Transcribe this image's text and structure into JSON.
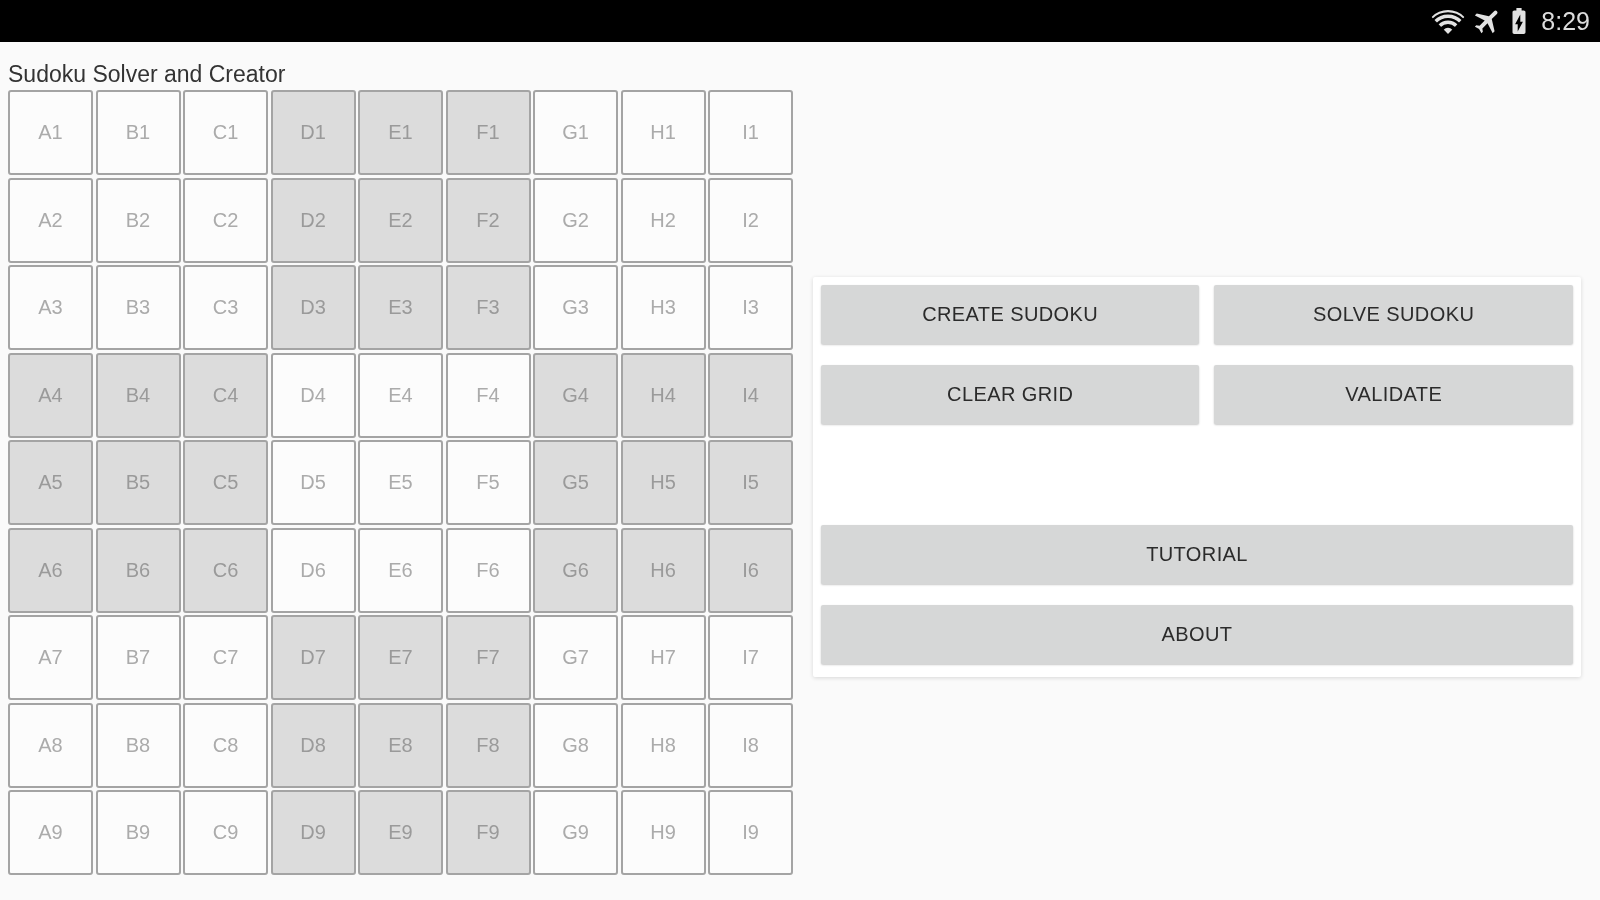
{
  "status_bar": {
    "time": "8:29"
  },
  "title": "Sudoku Solver and Creator",
  "grid": {
    "rows": [
      {
        "cells": [
          {
            "placeholder": "A1",
            "shaded": false
          },
          {
            "placeholder": "B1",
            "shaded": false
          },
          {
            "placeholder": "C1",
            "shaded": false
          },
          {
            "placeholder": "D1",
            "shaded": true
          },
          {
            "placeholder": "E1",
            "shaded": true
          },
          {
            "placeholder": "F1",
            "shaded": true
          },
          {
            "placeholder": "G1",
            "shaded": false
          },
          {
            "placeholder": "H1",
            "shaded": false
          },
          {
            "placeholder": "I1",
            "shaded": false
          }
        ]
      },
      {
        "cells": [
          {
            "placeholder": "A2",
            "shaded": false
          },
          {
            "placeholder": "B2",
            "shaded": false
          },
          {
            "placeholder": "C2",
            "shaded": false
          },
          {
            "placeholder": "D2",
            "shaded": true
          },
          {
            "placeholder": "E2",
            "shaded": true
          },
          {
            "placeholder": "F2",
            "shaded": true
          },
          {
            "placeholder": "G2",
            "shaded": false
          },
          {
            "placeholder": "H2",
            "shaded": false
          },
          {
            "placeholder": "I2",
            "shaded": false
          }
        ]
      },
      {
        "cells": [
          {
            "placeholder": "A3",
            "shaded": false
          },
          {
            "placeholder": "B3",
            "shaded": false
          },
          {
            "placeholder": "C3",
            "shaded": false
          },
          {
            "placeholder": "D3",
            "shaded": true
          },
          {
            "placeholder": "E3",
            "shaded": true
          },
          {
            "placeholder": "F3",
            "shaded": true
          },
          {
            "placeholder": "G3",
            "shaded": false
          },
          {
            "placeholder": "H3",
            "shaded": false
          },
          {
            "placeholder": "I3",
            "shaded": false
          }
        ]
      },
      {
        "cells": [
          {
            "placeholder": "A4",
            "shaded": true
          },
          {
            "placeholder": "B4",
            "shaded": true
          },
          {
            "placeholder": "C4",
            "shaded": true
          },
          {
            "placeholder": "D4",
            "shaded": false
          },
          {
            "placeholder": "E4",
            "shaded": false
          },
          {
            "placeholder": "F4",
            "shaded": false
          },
          {
            "placeholder": "G4",
            "shaded": true
          },
          {
            "placeholder": "H4",
            "shaded": true
          },
          {
            "placeholder": "I4",
            "shaded": true
          }
        ]
      },
      {
        "cells": [
          {
            "placeholder": "A5",
            "shaded": true
          },
          {
            "placeholder": "B5",
            "shaded": true
          },
          {
            "placeholder": "C5",
            "shaded": true
          },
          {
            "placeholder": "D5",
            "shaded": false
          },
          {
            "placeholder": "E5",
            "shaded": false
          },
          {
            "placeholder": "F5",
            "shaded": false
          },
          {
            "placeholder": "G5",
            "shaded": true
          },
          {
            "placeholder": "H5",
            "shaded": true
          },
          {
            "placeholder": "I5",
            "shaded": true
          }
        ]
      },
      {
        "cells": [
          {
            "placeholder": "A6",
            "shaded": true
          },
          {
            "placeholder": "B6",
            "shaded": true
          },
          {
            "placeholder": "C6",
            "shaded": true
          },
          {
            "placeholder": "D6",
            "shaded": false
          },
          {
            "placeholder": "E6",
            "shaded": false
          },
          {
            "placeholder": "F6",
            "shaded": false
          },
          {
            "placeholder": "G6",
            "shaded": true
          },
          {
            "placeholder": "H6",
            "shaded": true
          },
          {
            "placeholder": "I6",
            "shaded": true
          }
        ]
      },
      {
        "cells": [
          {
            "placeholder": "A7",
            "shaded": false
          },
          {
            "placeholder": "B7",
            "shaded": false
          },
          {
            "placeholder": "C7",
            "shaded": false
          },
          {
            "placeholder": "D7",
            "shaded": true
          },
          {
            "placeholder": "E7",
            "shaded": true
          },
          {
            "placeholder": "F7",
            "shaded": true
          },
          {
            "placeholder": "G7",
            "shaded": false
          },
          {
            "placeholder": "H7",
            "shaded": false
          },
          {
            "placeholder": "I7",
            "shaded": false
          }
        ]
      },
      {
        "cells": [
          {
            "placeholder": "A8",
            "shaded": false
          },
          {
            "placeholder": "B8",
            "shaded": false
          },
          {
            "placeholder": "C8",
            "shaded": false
          },
          {
            "placeholder": "D8",
            "shaded": true
          },
          {
            "placeholder": "E8",
            "shaded": true
          },
          {
            "placeholder": "F8",
            "shaded": true
          },
          {
            "placeholder": "G8",
            "shaded": false
          },
          {
            "placeholder": "H8",
            "shaded": false
          },
          {
            "placeholder": "I8",
            "shaded": false
          }
        ]
      },
      {
        "cells": [
          {
            "placeholder": "A9",
            "shaded": false
          },
          {
            "placeholder": "B9",
            "shaded": false
          },
          {
            "placeholder": "C9",
            "shaded": false
          },
          {
            "placeholder": "D9",
            "shaded": true
          },
          {
            "placeholder": "E9",
            "shaded": true
          },
          {
            "placeholder": "F9",
            "shaded": true
          },
          {
            "placeholder": "G9",
            "shaded": false
          },
          {
            "placeholder": "H9",
            "shaded": false
          },
          {
            "placeholder": "I9",
            "shaded": false
          }
        ]
      }
    ]
  },
  "top_buttons": [
    [
      "CREATE SUDOKU",
      "SOLVE SUDOKU"
    ],
    [
      "CLEAR GRID",
      "VALIDATE"
    ]
  ],
  "bottom_buttons": [
    "TUTORIAL",
    "ABOUT"
  ]
}
